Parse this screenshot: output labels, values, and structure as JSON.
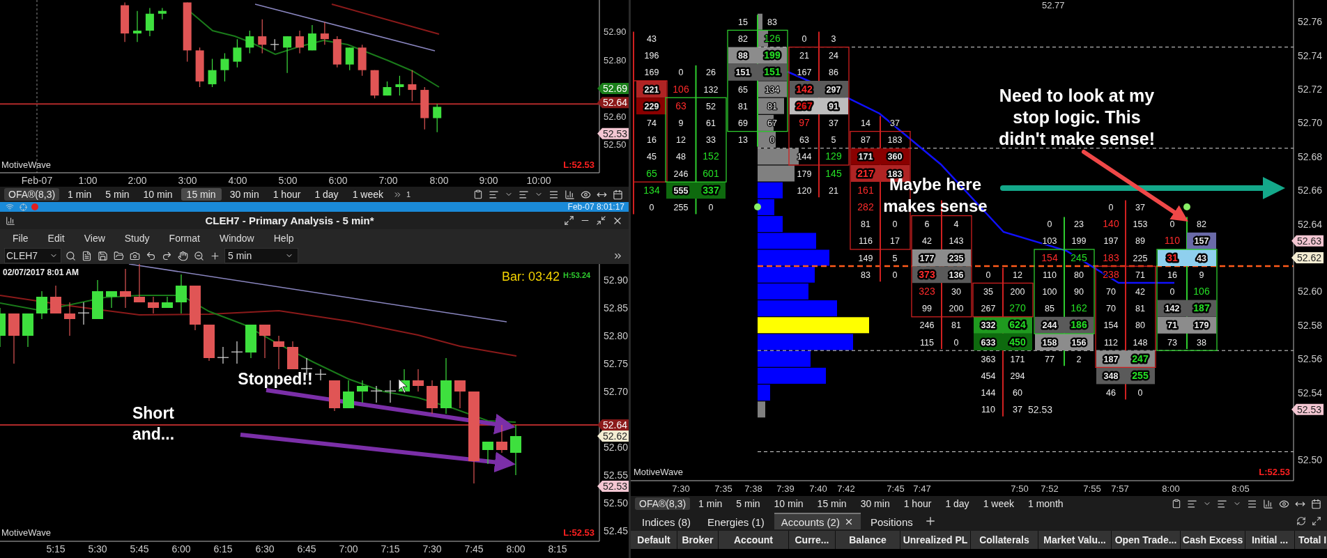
{
  "top_chart": {
    "price_labels": [
      "52.90",
      "52.80",
      "52.60",
      "52.50"
    ],
    "price_tags": [
      {
        "text": "52.69",
        "color": "#1a7f1a"
      },
      {
        "text": "52.64",
        "color": "#8b1a1a"
      },
      {
        "text": "52.53",
        "color": "#f3c6d2"
      }
    ],
    "time_labels": [
      "Feb-07",
      "1:00",
      "2:00",
      "3:00",
      "4:00",
      "5:00",
      "6:00",
      "7:00",
      "8:00",
      "9:00",
      "10:00"
    ],
    "corner_label": "MotiveWave",
    "low_label": "L:52.53"
  },
  "top_toolbar": {
    "study_label": "OFA®(8,3)",
    "intervals": [
      {
        "label": "1 min",
        "selected": false
      },
      {
        "label": "5 min",
        "selected": false
      },
      {
        "label": "10 min",
        "selected": false
      },
      {
        "label": "15 min",
        "selected": true
      },
      {
        "label": "30 min",
        "selected": false
      },
      {
        "label": "1 hour",
        "selected": false
      },
      {
        "label": "1 day",
        "selected": false
      },
      {
        "label": "1 week",
        "selected": false
      }
    ],
    "overflow_count": "1"
  },
  "status_strip": {
    "datetime": "Feb-07 8:01:17"
  },
  "window": {
    "title": "CLEH7 - Primary Analysis - 5 min*"
  },
  "menu": [
    "File",
    "Edit",
    "View",
    "Study",
    "Format",
    "Window",
    "Help"
  ],
  "chart_toolbar": {
    "symbol": "CLEH7",
    "interval": "5 min"
  },
  "main_chart": {
    "timestamp": "02/07/2017 8:01 AM",
    "bar_timer": "Bar: 03:42",
    "high_label": "H:53.24",
    "price_labels": [
      "52.90",
      "52.85",
      "52.80",
      "52.75",
      "52.70",
      "52.60",
      "52.55",
      "52.50",
      "52.45"
    ],
    "price_tags": [
      {
        "text": "52.64",
        "color": "#8b1a1a"
      },
      {
        "text": "52.62",
        "color": "#f3ecd2"
      },
      {
        "text": "52.53",
        "color": "#f3c6d2"
      }
    ],
    "time_labels": [
      "5:15",
      "5:30",
      "5:45",
      "6:00",
      "6:15",
      "6:30",
      "6:45",
      "7:00",
      "7:15",
      "7:30",
      "7:45",
      "8:00",
      "8:15"
    ],
    "corner_label": "MotiveWave",
    "low_label": "L:52.53",
    "annotations": [
      {
        "lines": [
          "Stopped!!"
        ]
      },
      {
        "lines": [
          "Short",
          "and..."
        ]
      }
    ]
  },
  "footprint_chart": {
    "top_label": "52.77",
    "last_price": "52.53",
    "price_labels": [
      "52.76",
      "52.74",
      "52.72",
      "52.70",
      "52.68",
      "52.66",
      "52.64",
      "52.60",
      "52.58",
      "52.56",
      "52.54",
      "52.50"
    ],
    "price_tags": [
      {
        "text": "52.63",
        "color": "#f3c6d2"
      },
      {
        "text": "52.62",
        "color": "#f3ecd2"
      },
      {
        "text": "52.53",
        "color": "#f3c6d2"
      }
    ],
    "columns": [
      {
        "color": "#d02020",
        "cells": [
          {
            "ask": {
              "text": "43"
            }
          },
          {
            "ask": {
              "text": "196"
            }
          },
          {
            "ask": {
              "text": "169"
            }
          },
          {
            "color": "#b02424",
            "ask": {
              "text": "221"
            }
          },
          {
            "color": "#8a0000",
            "ask": {
              "text": "229"
            }
          },
          {
            "ask": {
              "text": "74"
            }
          },
          {
            "ask": {
              "text": "16"
            }
          },
          {
            "ask": {
              "text": "45"
            }
          },
          {
            "ask": {
              "text": "65",
              "color": "#25e025"
            }
          },
          {
            "ask": {
              "text": "134",
              "color": "#25e025"
            }
          },
          {
            "ask": {
              "text": "0"
            }
          }
        ]
      },
      {
        "color": "#2ecc2e",
        "cells": [
          {
            "bid": {
              "text": "0"
            },
            "ask": {
              "text": "26"
            }
          },
          {
            "bid": {
              "text": "106",
              "color": "#ff2a2a"
            },
            "ask": {
              "text": "132"
            }
          },
          {
            "bid": {
              "text": "63",
              "color": "#ff2a2a"
            },
            "ask": {
              "text": "52"
            }
          },
          {
            "bid": {
              "text": "9"
            },
            "ask": {
              "text": "61"
            }
          },
          {
            "bid": {
              "text": "12"
            },
            "ask": {
              "text": "33"
            }
          },
          {
            "bid": {
              "text": "48"
            },
            "ask": {
              "text": "152",
              "color": "#25e025"
            }
          },
          {
            "bid": {
              "text": "246"
            },
            "ask": {
              "text": "601",
              "color": "#25e025"
            }
          },
          {
            "color": "#0e6a0e",
            "bid": {
              "text": "555"
            },
            "ask": {
              "text": "337",
              "color": "#25e025"
            }
          },
          {
            "bid": {
              "text": "255"
            },
            "ask": {
              "text": "0"
            }
          }
        ]
      },
      {
        "color": "#2ecc2e",
        "cells": [
          {
            "bid": {
              "text": "15"
            },
            "ask": {
              "text": "83"
            }
          },
          {
            "bid": {
              "text": "82"
            },
            "ask": {
              "text": "126",
              "color": "#25e025"
            }
          },
          {
            "color": "#8c8c8c",
            "bid": {
              "text": "88"
            },
            "ask": {
              "text": "199",
              "color": "#25e025"
            }
          },
          {
            "color": "#5a5a5a",
            "bid": {
              "text": "151"
            },
            "ask": {
              "text": "151",
              "color": "#25e025"
            }
          },
          {
            "bid": {
              "text": "65"
            },
            "ask": {
              "text": "134"
            }
          },
          {
            "bid": {
              "text": "81"
            },
            "ask": {
              "text": "81"
            }
          },
          {
            "bid": {
              "text": "69"
            },
            "ask": {
              "text": "67"
            }
          },
          {
            "bid": {
              "text": "13"
            },
            "ask": {
              "text": "0"
            }
          }
        ]
      },
      {
        "color": "#d02020",
        "cells": [
          {
            "bid": {
              "text": "0"
            },
            "ask": {
              "text": "3"
            }
          },
          {
            "bid": {
              "text": "21"
            },
            "ask": {
              "text": "24"
            }
          },
          {
            "bid": {
              "text": "167"
            },
            "ask": {
              "text": "86"
            }
          },
          {
            "color": "#5a5a5a",
            "bid": {
              "text": "142",
              "color": "#ff2a2a"
            },
            "ask": {
              "text": "297"
            }
          },
          {
            "color": "#bdbdbd",
            "bid": {
              "text": "267",
              "color": "#e81010"
            },
            "ask": {
              "text": "91"
            }
          },
          {
            "bid": {
              "text": "97",
              "color": "#ff2a2a"
            },
            "ask": {
              "text": "37"
            }
          },
          {
            "bid": {
              "text": "63"
            },
            "ask": {
              "text": "5"
            }
          },
          {
            "bid": {
              "text": "144"
            },
            "ask": {
              "text": "129",
              "color": "#25e025"
            }
          },
          {
            "bid": {
              "text": "179"
            },
            "ask": {
              "text": "145",
              "color": "#25e025"
            }
          },
          {
            "bid": {
              "text": "120"
            },
            "ask": {
              "text": "21"
            }
          }
        ]
      },
      {
        "color": "#d02020",
        "cells": [
          {
            "bid": {
              "text": "14"
            },
            "ask": {
              "text": "37"
            }
          },
          {
            "bid": {
              "text": "87"
            },
            "ask": {
              "text": "183"
            }
          },
          {
            "color": "#8a0000",
            "bid": {
              "text": "171"
            },
            "ask": {
              "text": "360"
            }
          },
          {
            "color": "#b02424",
            "bid": {
              "text": "217",
              "color": "#ff2a2a"
            },
            "ask": {
              "text": "183"
            }
          },
          {
            "bid": {
              "text": "161",
              "color": "#ff2a2a"
            }
          },
          {
            "bid": {
              "text": "282",
              "color": "#ff2a2a"
            }
          },
          {
            "bid": {
              "text": "81"
            },
            "ask": {
              "text": "0"
            }
          },
          {
            "bid": {
              "text": "116"
            },
            "ask": {
              "text": "17"
            }
          },
          {
            "bid": {
              "text": "149"
            },
            "ask": {
              "text": "5"
            }
          },
          {
            "bid": {
              "text": "83"
            },
            "ask": {
              "text": "0"
            }
          }
        ]
      },
      {
        "color": "#d02020",
        "cells": [
          {},
          {
            "bid": {
              "text": "6"
            },
            "ask": {
              "text": "4"
            }
          },
          {
            "bid": {
              "text": "42"
            },
            "ask": {
              "text": "143"
            }
          },
          {
            "color": "#8c8c8c",
            "bid": {
              "text": "177"
            },
            "ask": {
              "text": "235"
            }
          },
          {
            "color": "#5a5a5a",
            "bid": {
              "text": "373",
              "color": "#ff2a2a"
            },
            "ask": {
              "text": "136"
            }
          },
          {
            "bid": {
              "text": "323",
              "color": "#ff2a2a"
            },
            "ask": {
              "text": "30"
            }
          },
          {
            "bid": {
              "text": "99"
            },
            "ask": {
              "text": "200"
            }
          },
          {
            "bid": {
              "text": "246"
            },
            "ask": {
              "text": "81"
            }
          },
          {
            "bid": {
              "text": "115"
            },
            "ask": {
              "text": "0"
            }
          }
        ]
      },
      {
        "color": "#d02020",
        "cells": [
          {
            "bid": {
              "text": "0"
            },
            "ask": {
              "text": "12"
            }
          },
          {
            "bid": {
              "text": "35"
            },
            "ask": {
              "text": "200"
            }
          },
          {
            "bid": {
              "text": "267"
            },
            "ask": {
              "text": "270",
              "color": "#25e025"
            }
          },
          {
            "color": "#1f9a1f",
            "bid": {
              "text": "332"
            },
            "ask": {
              "text": "624",
              "color": "#25e025"
            }
          },
          {
            "color": "#0e6a0e",
            "bid": {
              "text": "633"
            },
            "ask": {
              "text": "450",
              "color": "#25e025"
            }
          },
          {
            "bid": {
              "text": "363"
            },
            "ask": {
              "text": "171"
            }
          },
          {
            "bid": {
              "text": "454"
            },
            "ask": {
              "text": "294"
            }
          },
          {
            "bid": {
              "text": "144"
            },
            "ask": {
              "text": "60"
            }
          },
          {
            "bid": {
              "text": "110"
            },
            "ask": {
              "text": "37"
            }
          }
        ]
      },
      {
        "color": "#2ecc2e",
        "cells": [
          {
            "bid": {
              "text": "0"
            },
            "ask": {
              "text": "23"
            }
          },
          {
            "bid": {
              "text": "103"
            },
            "ask": {
              "text": "199"
            }
          },
          {
            "bid": {
              "text": "154",
              "color": "#ff2a2a"
            },
            "ask": {
              "text": "245",
              "color": "#25e025"
            }
          },
          {
            "bid": {
              "text": "110"
            },
            "ask": {
              "text": "80"
            }
          },
          {
            "bid": {
              "text": "100"
            },
            "ask": {
              "text": "90"
            }
          },
          {
            "bid": {
              "text": "85"
            },
            "ask": {
              "text": "162",
              "color": "#25e025"
            }
          },
          {
            "color": "#5a5a5a",
            "bid": {
              "text": "244"
            },
            "ask": {
              "text": "186",
              "color": "#25e025"
            }
          },
          {
            "color": "#8c8c8c",
            "bid": {
              "text": "158"
            },
            "ask": {
              "text": "156"
            }
          },
          {
            "bid": {
              "text": "77"
            },
            "ask": {
              "text": "2"
            }
          }
        ]
      },
      {
        "color": "#d02020",
        "cells": [
          {
            "bid": {
              "text": "0"
            },
            "ask": {
              "text": "37"
            }
          },
          {
            "bid": {
              "text": "140",
              "color": "#ff2a2a"
            },
            "ask": {
              "text": "153"
            }
          },
          {
            "bid": {
              "text": "197"
            },
            "ask": {
              "text": "89"
            }
          },
          {
            "bid": {
              "text": "183",
              "color": "#ff2a2a"
            },
            "ask": {
              "text": "225"
            }
          },
          {
            "bid": {
              "text": "238",
              "color": "#ff2a2a"
            },
            "ask": {
              "text": "71"
            }
          },
          {
            "bid": {
              "text": "70"
            },
            "ask": {
              "text": "42"
            }
          },
          {
            "bid": {
              "text": "70"
            },
            "ask": {
              "text": "81"
            }
          },
          {
            "bid": {
              "text": "154"
            },
            "ask": {
              "text": "80"
            }
          },
          {
            "bid": {
              "text": "112"
            },
            "ask": {
              "text": "148"
            }
          },
          {
            "color": "#8c8c8c",
            "bid": {
              "text": "187"
            },
            "ask": {
              "text": "247",
              "color": "#25e025"
            }
          },
          {
            "color": "#5a5a5a",
            "bid": {
              "text": "348"
            },
            "ask": {
              "text": "255",
              "color": "#25e025"
            }
          },
          {
            "bid": {
              "text": "46"
            },
            "ask": {
              "text": "0"
            }
          }
        ]
      },
      {
        "color": "#2ecc2e",
        "cells": [
          {
            "bid": {
              "text": "0"
            },
            "ask": {
              "text": "82"
            }
          },
          {
            "bid": {
              "text": "110",
              "color": "#ff2a2a"
            },
            "ask": {
              "text": "157",
              "highlight": {
                "color": "#6a6aa8"
              }
            }
          },
          {
            "color": "#8fd0ee",
            "bid": {
              "text": "31",
              "color": "#ff2a2a"
            },
            "ask": {
              "text": "43"
            }
          },
          {
            "bid": {
              "text": "16"
            },
            "ask": {
              "text": "9"
            }
          },
          {
            "bid": {
              "text": "0"
            },
            "ask": {
              "text": "106",
              "color": "#25e025"
            }
          },
          {
            "color": "#5a5a5a",
            "bid": {
              "text": "142"
            },
            "ask": {
              "text": "187",
              "color": "#25e025"
            }
          },
          {
            "color": "#8c8c8c",
            "bid": {
              "text": "71"
            },
            "ask": {
              "text": "179"
            }
          },
          {
            "bid": {
              "text": "73"
            },
            "ask": {
              "text": "38"
            }
          }
        ]
      }
    ],
    "annotations": [
      {
        "lines": [
          "Need to look at my",
          "stop logic. This",
          "didn't make sense!"
        ]
      },
      {
        "lines": [
          "Maybe here",
          "makes sense"
        ]
      }
    ],
    "time_labels": [
      "7:30",
      "7:35",
      "7:38",
      "7:39",
      "7:40",
      "7:42",
      "7:45",
      "7:47",
      "7:50",
      "7:52",
      "7:55",
      "7:57",
      "8:00",
      "8:05"
    ],
    "corner_label": "MotiveWave",
    "low_label": "L:52.53"
  },
  "bottom_toolbar": {
    "study_label": "OFA®(8,3)",
    "intervals": [
      {
        "label": "1 min",
        "selected": false
      },
      {
        "label": "5 min",
        "selected": false
      },
      {
        "label": "10 min",
        "selected": false
      },
      {
        "label": "15 min",
        "selected": false
      },
      {
        "label": "30 min",
        "selected": false
      },
      {
        "label": "1 hour",
        "selected": false
      },
      {
        "label": "1 day",
        "selected": false
      },
      {
        "label": "1 week",
        "selected": false
      },
      {
        "label": "1 month",
        "selected": false
      }
    ]
  },
  "tabs": [
    {
      "label": "Indices (8)",
      "selected": false
    },
    {
      "label": "Energies (1)",
      "selected": false
    },
    {
      "label": "Accounts (2)",
      "selected": true
    },
    {
      "label": "Positions",
      "selected": false
    }
  ],
  "table": {
    "columns": [
      "Default",
      "Broker",
      "Account",
      "Curre...",
      "Balance",
      "Unrealized PL",
      "Collaterals",
      "Market Valu...",
      "Open Trade...",
      "Cash Excess",
      "Initial ...",
      "Total I"
    ]
  }
}
